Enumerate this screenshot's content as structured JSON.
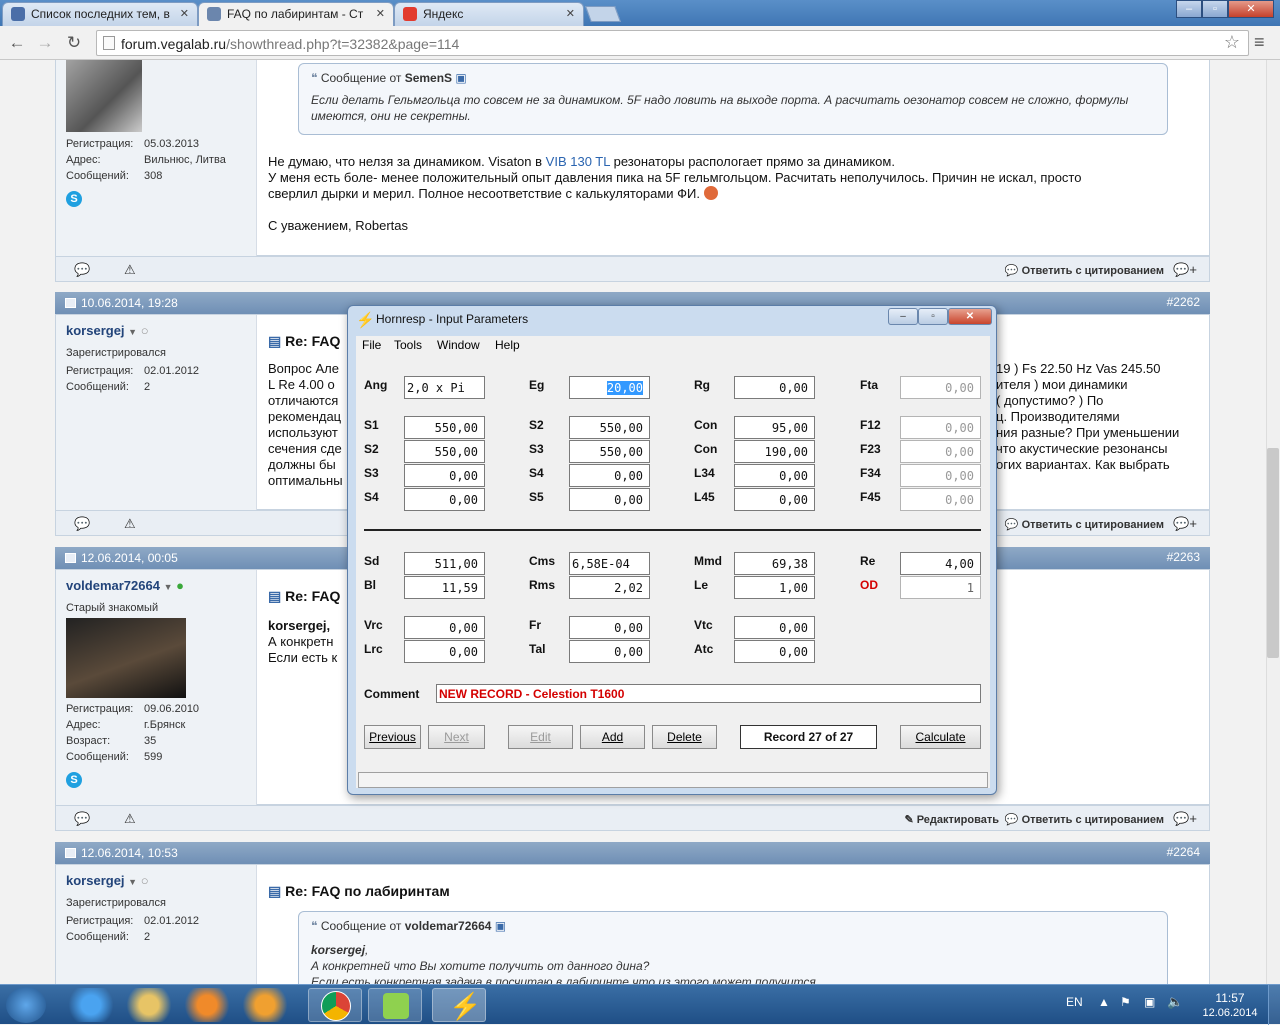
{
  "browser": {
    "tabs": [
      {
        "title": "Список последних тем, в"
      },
      {
        "title": "FAQ по лабиринтам - Ст"
      },
      {
        "title": "Яндекс"
      }
    ],
    "url_host": "forum.vegalab.ru",
    "url_path": "/showthread.php?t=32382&page=114"
  },
  "posts": {
    "p0": {
      "reg_label": "Регистрация:",
      "reg": "05.03.2013",
      "addr_label": "Адрес:",
      "addr": "Вильнюс, Литва",
      "msgs_label": "Сообщений:",
      "msgs": "308",
      "quote_head": "Сообщение от",
      "quote_author": "SemenS",
      "quote_text": "Если делать Гельмгольца то совсем не за динамиком. 5F надо ловить на выходе порта. А расчитать оезонатор совсем не сложно, формулы имеются, они не секретны.",
      "body_l1a": "Не думаю, что нелзя за динамиком. Visaton в",
      "body_link": "VIB 130 TL",
      "body_l1b": "резонаторы распологает прямо за динамиком.",
      "body_l2": "У меня есть боле- менее положительный опыт давления пика на 5F гельмгольцом. Расчитать неполучилось. Причин не искал, просто",
      "body_l3": "сверлил дырки и мерил. Полное несоответствие с калькуляторами ФИ.",
      "sign": "С уважением, Robertas",
      "reply_quote": "Ответить с цитированием"
    },
    "p1": {
      "date": "10.06.2014, 19:28",
      "num": "#2262",
      "user": "korsergej",
      "rank": "Зарегистрировался",
      "reg_label": "Регистрация:",
      "reg": "02.01.2012",
      "msgs_label": "Сообщений:",
      "msgs": "2",
      "title": "Re: FAQ",
      "lines_left": [
        "Вопрос Але",
        "L Re 4.00 о",
        "отличаются",
        "рекомендац",
        "используют",
        "сечения сде",
        "должны бы",
        "оптимальны"
      ],
      "lines_right": [
        "19 ) Fs 22.50 Hz Vas 245.50",
        "ителя ) мои динамики",
        "( допустимо? ) По",
        "ц. Производителями",
        "ния разные? При уменьшении",
        "что акустические резонансы",
        "огих вариантах. Как выбрать"
      ],
      "reply_quote": "Ответить с цитированием"
    },
    "p2": {
      "date": "12.06.2014, 00:05",
      "num": "#2263",
      "user": "voldemar72664",
      "rank": "Старый знакомый",
      "reg_label": "Регистрация:",
      "reg": "09.06.2010",
      "addr_label": "Адрес:",
      "addr": "г.Брянск",
      "age_label": "Возраст:",
      "age": "35",
      "msgs_label": "Сообщений:",
      "msgs": "599",
      "title": "Re: FAQ",
      "l1": "korsergej,",
      "l2": "А конкретн",
      "l3": "Если есть к",
      "edit": "Редактировать",
      "reply_quote": "Ответить с цитированием"
    },
    "p3": {
      "date": "12.06.2014, 10:53",
      "num": "#2264",
      "user": "korsergej",
      "rank": "Зарегистрировался",
      "reg_label": "Регистрация:",
      "reg": "02.01.2012",
      "msgs_label": "Сообщений:",
      "msgs": "2",
      "title": "Re: FAQ по лабиринтам",
      "quote_head": "Сообщение от",
      "quote_author": "voldemar72664",
      "q1": "korsergej",
      "q2": "А конкретней что Вы хотите получить от данного дина?",
      "q3": "Если есть конкретная задача в посчитаю в лабиринте что из этого может получится"
    }
  },
  "dialog": {
    "title": "Hornresp - Input Parameters",
    "menu": [
      "File",
      "Tools",
      "Window",
      "Help"
    ],
    "r1": {
      "ang_l": "Ang",
      "ang": "2,0 x Pi",
      "eg_l": "Eg",
      "eg": "20,00",
      "rg_l": "Rg",
      "rg": "0,00",
      "fta_l": "Fta",
      "fta": "0,00"
    },
    "g1": {
      "s1_l": "S1",
      "s1": "550,00",
      "s2a_l": "S2",
      "s2a": "550,00",
      "con1_l": "Con",
      "con1": "95,00",
      "f12_l": "F12",
      "f12": "0,00",
      "s2_l": "S2",
      "s2": "550,00",
      "s3a_l": "S3",
      "s3a": "550,00",
      "con2_l": "Con",
      "con2": "190,00",
      "f23_l": "F23",
      "f23": "0,00",
      "s3_l": "S3",
      "s3": "0,00",
      "s4a_l": "S4",
      "s4a": "0,00",
      "l34_l": "L34",
      "l34": "0,00",
      "f34_l": "F34",
      "f34": "0,00",
      "s4_l": "S4",
      "s4": "0,00",
      "s5_l": "S5",
      "s5": "0,00",
      "l45_l": "L45",
      "l45": "0,00",
      "f45_l": "F45",
      "f45": "0,00"
    },
    "g2": {
      "sd_l": "Sd",
      "sd": "511,00",
      "cms_l": "Cms",
      "cms": "6,58E-04",
      "mmd_l": "Mmd",
      "mmd": "69,38",
      "re_l": "Re",
      "re": "4,00",
      "bl_l": "Bl",
      "bl": "11,59",
      "rms_l": "Rms",
      "rms": "2,02",
      "le_l": "Le",
      "le": "1,00",
      "od_l": "OD",
      "od": "1"
    },
    "g3": {
      "vrc_l": "Vrc",
      "vrc": "0,00",
      "fr_l": "Fr",
      "fr": "0,00",
      "vtc_l": "Vtc",
      "vtc": "0,00",
      "lrc_l": "Lrc",
      "lrc": "0,00",
      "tal_l": "Tal",
      "tal": "0,00",
      "atc_l": "Atc",
      "atc": "0,00"
    },
    "comment_l": "Comment",
    "comment": "NEW RECORD - Celestion T1600",
    "buttons": {
      "prev": "Previous",
      "next": "Next",
      "edit": "Edit",
      "add": "Add",
      "delete": "Delete",
      "record": "Record 27 of 27",
      "calc": "Calculate"
    },
    "accent_red": "#d40000"
  },
  "taskbar": {
    "lang": "EN",
    "time": "11:57",
    "date": "12.06.2014"
  }
}
